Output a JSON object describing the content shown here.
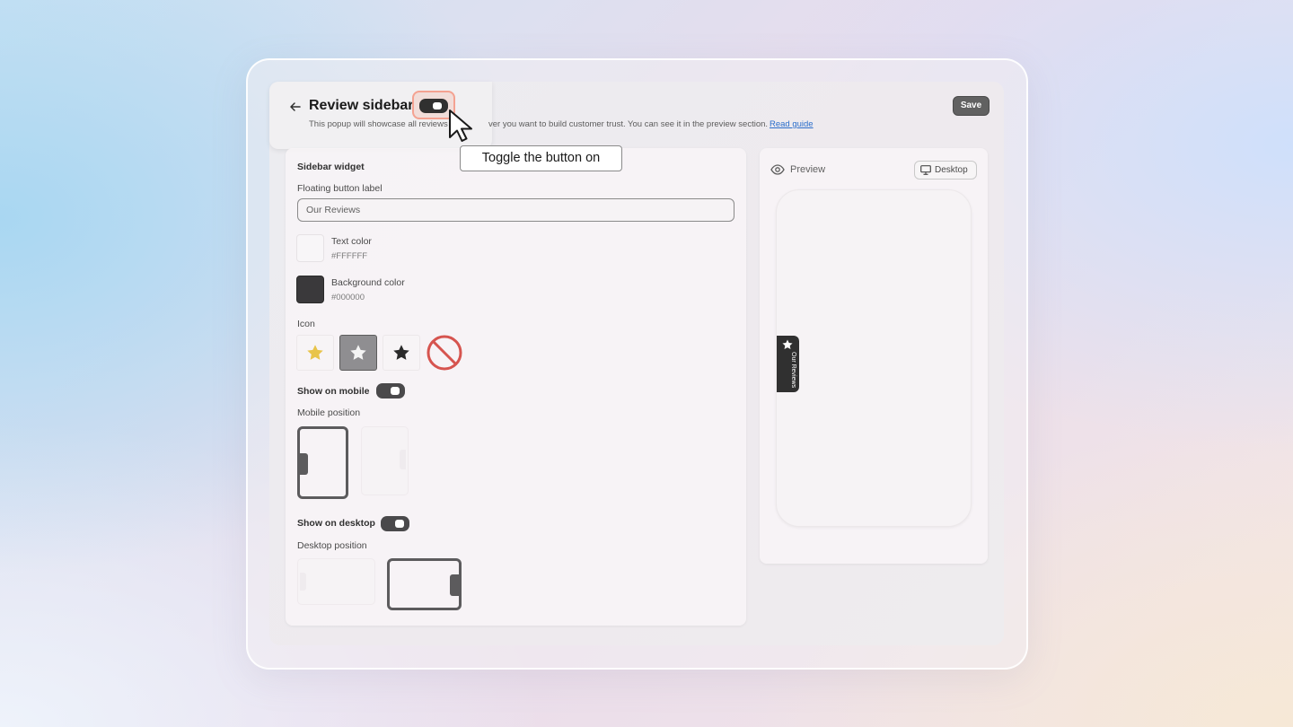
{
  "header": {
    "title": "Review sidebar",
    "subtitle": "This popup will showcase all reviews",
    "subtitle_rest": "ver you want to build customer trust. You can see it in the preview section.",
    "read_guide_label": "Read guide",
    "widget_enabled": false,
    "save_label": "Save"
  },
  "tooltip": {
    "text": "Toggle the button on"
  },
  "settings": {
    "section_title": "Sidebar widget",
    "floating_button_label": "Floating button label",
    "floating_button_value": "Our Reviews",
    "text_color_label": "Text color",
    "text_color_value": "#FFFFFF",
    "background_color_label": "Background color",
    "background_color_value": "#000000",
    "icon_label": "Icon",
    "icons": [
      "star-filled-yellow-icon",
      "star-outline-icon",
      "star-filled-dark-icon",
      "no-icon"
    ],
    "selected_icon": "star-outline-icon",
    "show_on_mobile_label": "Show on mobile",
    "show_on_mobile": true,
    "mobile_position_label": "Mobile position",
    "mobile_position_selected": "left",
    "show_on_desktop_label": "Show on desktop",
    "show_on_desktop": true,
    "desktop_position_label": "Desktop position",
    "desktop_position_selected": "right"
  },
  "preview": {
    "label": "Preview",
    "device_label": "Desktop",
    "floating_tab_text": "Our Reviews"
  },
  "colors": {
    "toggle_on": "#303030",
    "highlight": "#f4a291",
    "link": "#2c6ecb",
    "save_button": "#616161",
    "star_yellow": "#e8c44a",
    "no_icon_red": "#d6544f"
  }
}
